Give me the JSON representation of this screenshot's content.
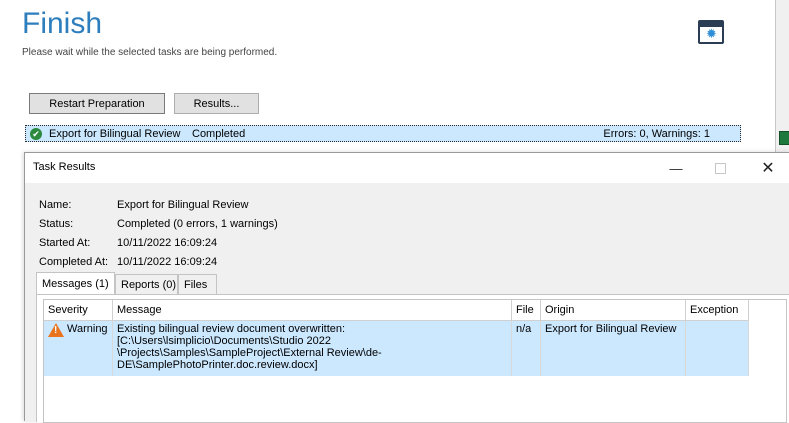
{
  "wizard": {
    "title": "Finish",
    "subtitle": "Please wait while the selected tasks are being performed.",
    "buttons": {
      "restart": "Restart Preparation",
      "results": "Results..."
    },
    "task": {
      "name": "Export for Bilingual Review",
      "status": "Completed",
      "counts": "Errors: 0, Warnings: 1"
    }
  },
  "dialog": {
    "title": "Task Results",
    "info": [
      {
        "label": "Name:",
        "value": "Export for Bilingual Review"
      },
      {
        "label": "Status:",
        "value": "Completed (0 errors, 1 warnings)"
      },
      {
        "label": "Started At:",
        "value": "10/11/2022 16:09:24"
      },
      {
        "label": "Completed At:",
        "value": "10/11/2022 16:09:24"
      }
    ],
    "tabs": [
      "Messages (1)",
      "Reports (0)",
      "Files"
    ],
    "columns": [
      "Severity",
      "Message",
      "File",
      "Origin",
      "Exception"
    ],
    "rows": [
      {
        "severity": "Warning",
        "message_lines": [
          "Existing bilingual review document overwritten:",
          "[C:\\Users\\lsimplicio\\Documents\\Studio 2022",
          "\\Projects\\Samples\\SampleProject\\External Review\\de-",
          "DE\\SamplePhotoPrinter.doc.review.docx]"
        ],
        "file": "n/a",
        "origin": "Export for Bilingual Review",
        "exception": ""
      }
    ]
  },
  "icons": {
    "settings": "settings-window-icon",
    "success": "check-circle-icon",
    "warning": "warning-icon"
  },
  "colors": {
    "title": "#2e7ebd",
    "selection": "#cce8ff",
    "success": "#2b8a3e",
    "warning": "#e8741e"
  }
}
